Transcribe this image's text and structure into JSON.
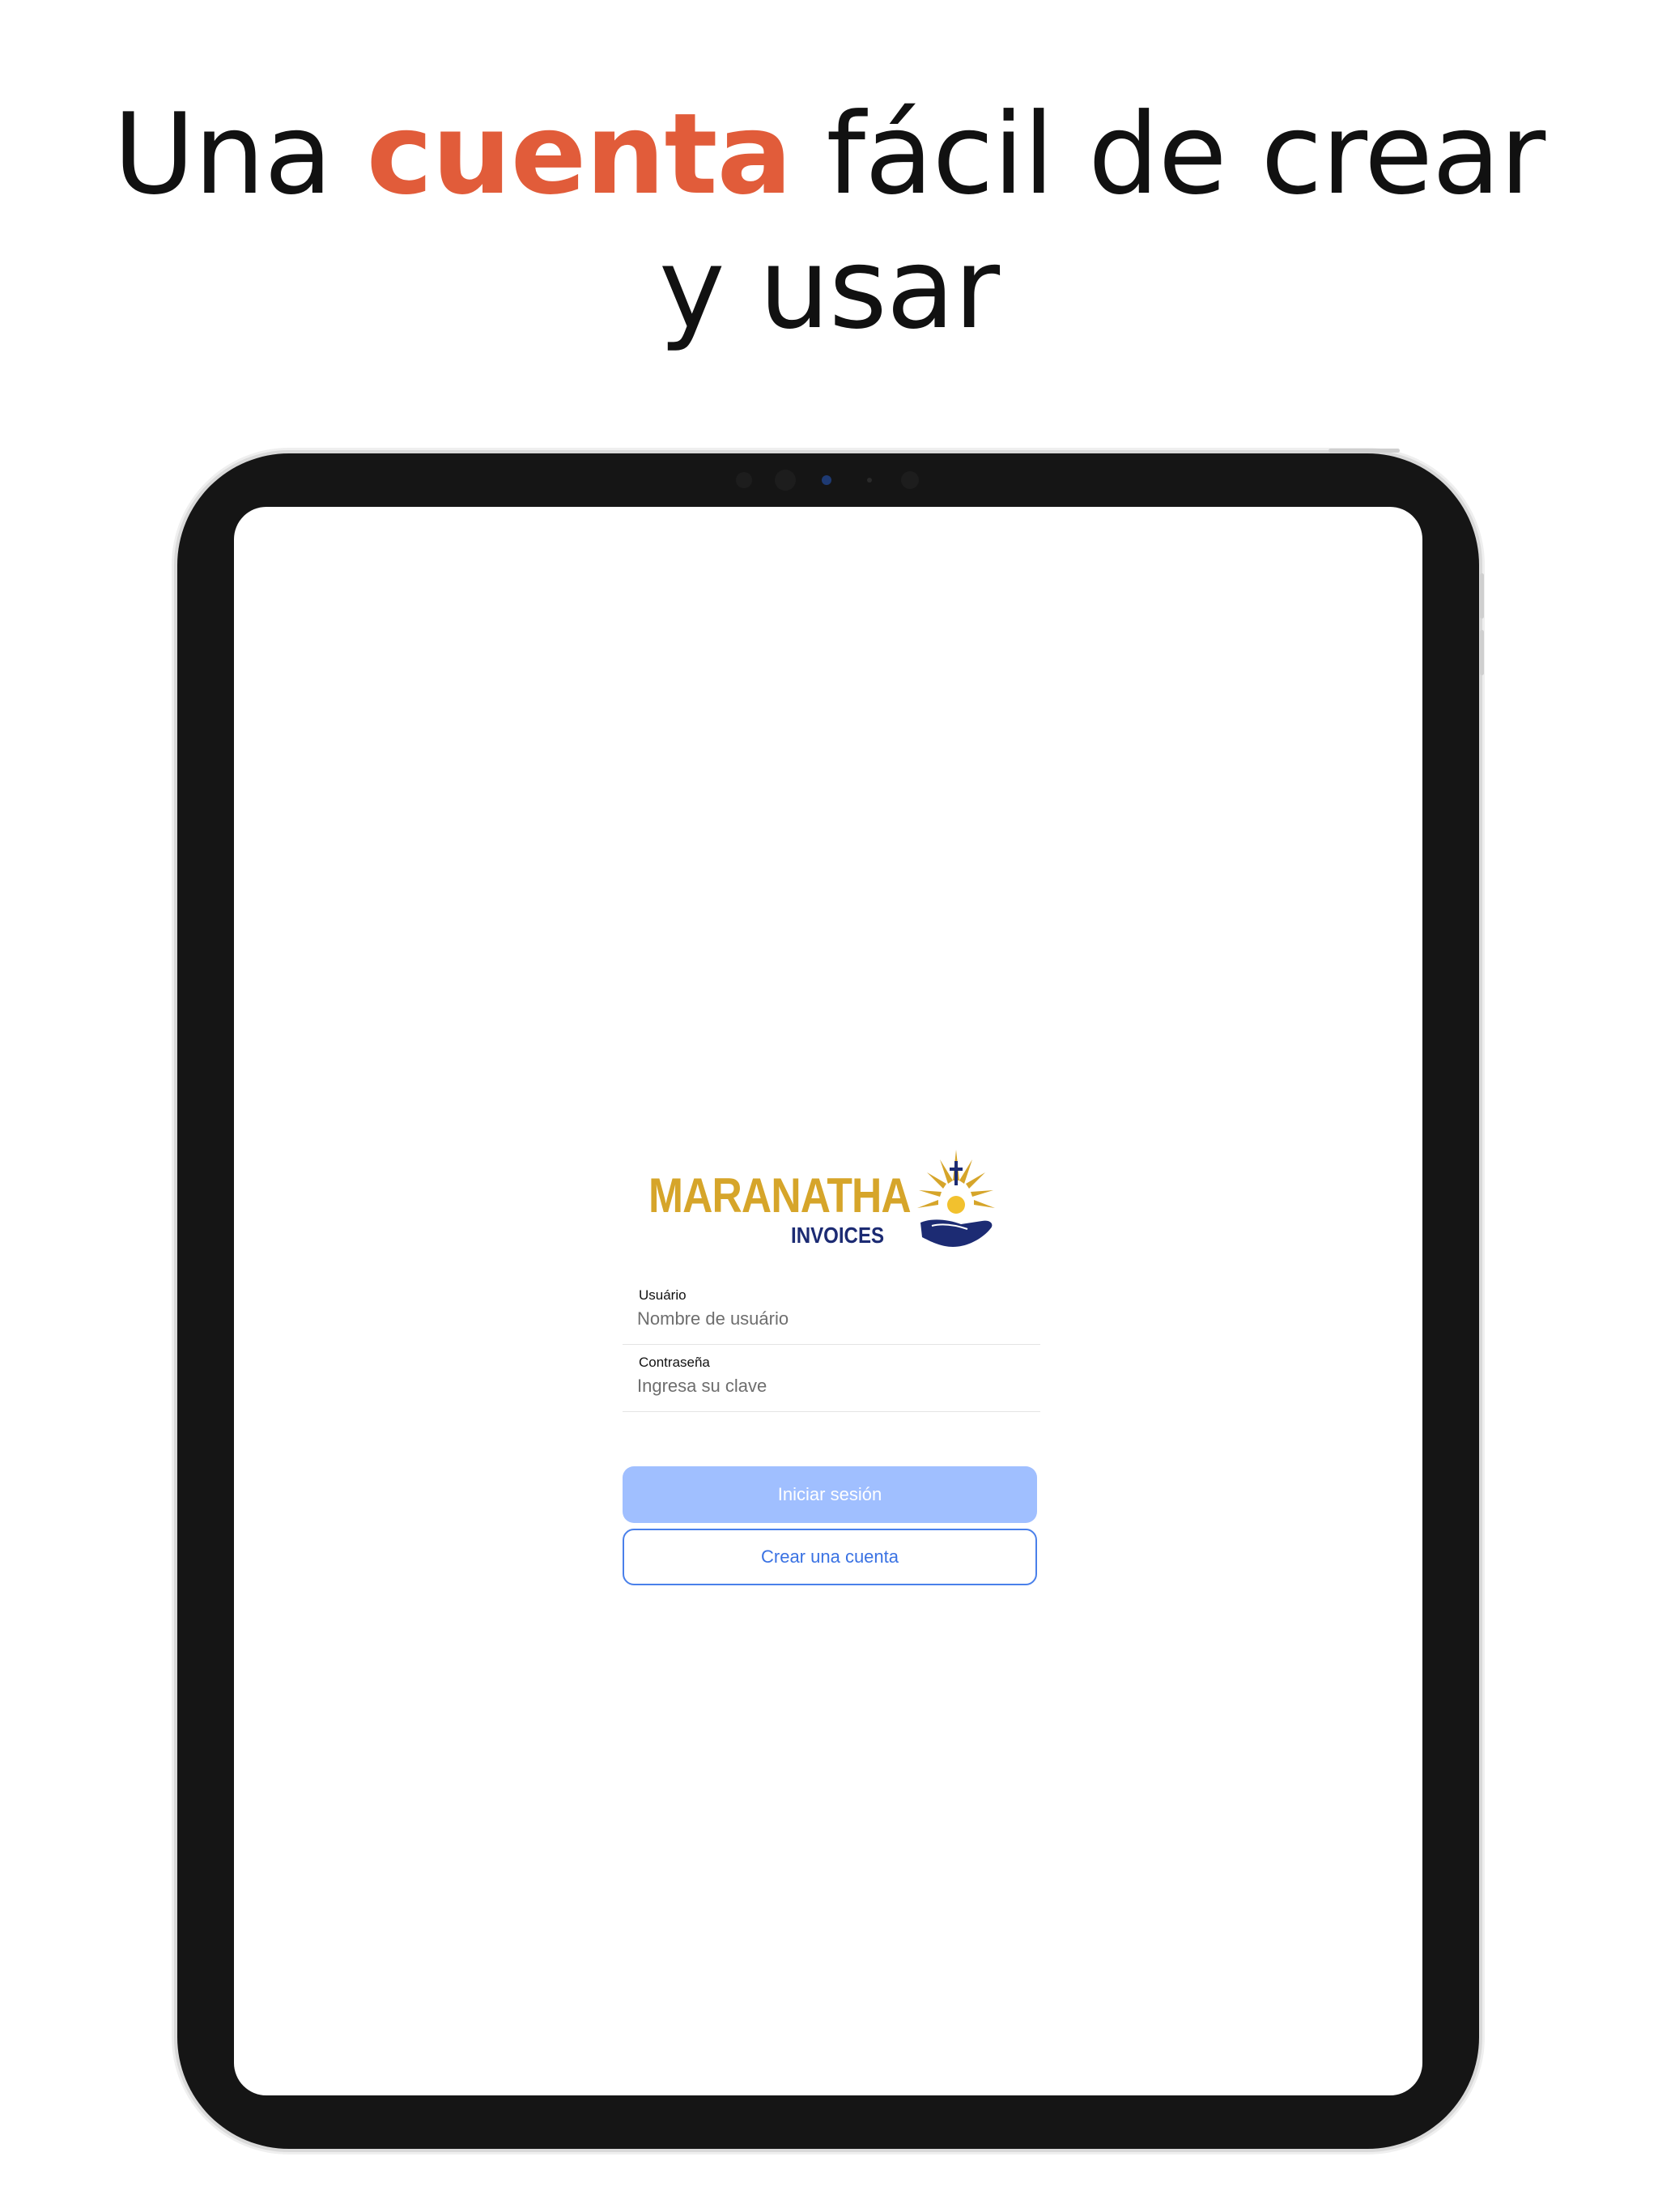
{
  "headline": {
    "before": "Una",
    "accent": "cuenta",
    "after": "fácil de crear y usar"
  },
  "colors": {
    "accent": "#e15c3a",
    "logo_gold": "#d6a52a",
    "logo_navy": "#1c2b73",
    "primary_button": "#a0bfff",
    "link_blue": "#3a72e3"
  },
  "logo": {
    "title": "MARANATHA",
    "subtitle": "INVOICES",
    "mark_icon": "sun-hand-cross-icon"
  },
  "form": {
    "username": {
      "label": "Usuário",
      "placeholder": "Nombre de usuário",
      "value": ""
    },
    "password": {
      "label": "Contraseña",
      "placeholder": "Ingresa su clave",
      "value": ""
    },
    "login_label": "Iniciar sesión",
    "create_account_label": "Crear una cuenta"
  }
}
